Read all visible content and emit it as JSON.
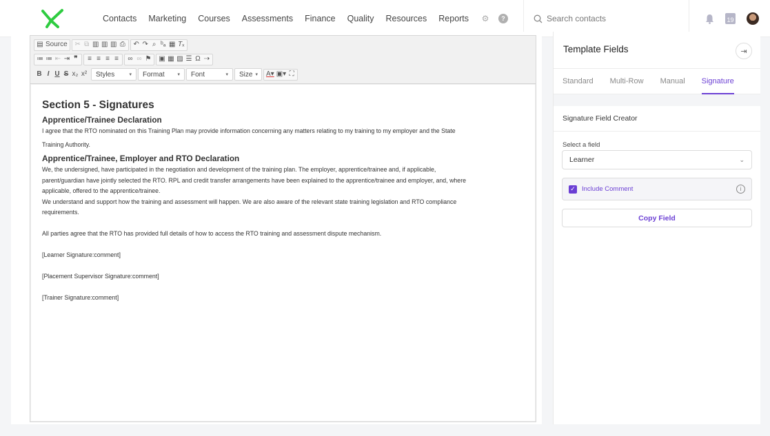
{
  "nav": {
    "items": [
      "Contacts",
      "Marketing",
      "Courses",
      "Assessments",
      "Finance",
      "Quality",
      "Resources",
      "Reports"
    ],
    "settings_icon": "gear-icon",
    "help_icon": "help-icon"
  },
  "search": {
    "placeholder": "Search contacts"
  },
  "header_right": {
    "calendar_day": "19"
  },
  "toolbar": {
    "source_label": "Source",
    "styles_label": "Styles",
    "format_label": "Format",
    "font_label": "Font",
    "size_label": "Size"
  },
  "document": {
    "heading": "Section 5 - Signatures",
    "sub1": "Apprentice/Trainee Declaration",
    "p1": "I agree that the RTO nominated on this Training Plan may provide information concerning any matters relating to my training to my employer and the State",
    "p1b": "Training Authority.",
    "sub2": "Apprentice/Trainee, Employer and RTO Declaration",
    "p2a": "We, the undersigned, have participated in the negotiation and development of the training plan.  The employer, apprentice/trainee and, if applicable,",
    "p2b": "parent/guardian have jointly selected the RTO.  RPL and credit transfer arrangements have been explained to the apprentice/trainee and employer, and, where",
    "p2c": "applicable, offered to the apprentice/trainee.",
    "p3a": "We understand and support how the training and assessment will happen. We are also aware of the relevant state training legislation and RTO compliance",
    "p3b": "requirements.",
    "p4": "All parties agree that the RTO has provided full details of how to access the RTO training and assessment dispute mechanism.",
    "sig1": "[Learner Signature:comment]",
    "sig2": "[Placement Supervisor Signature:comment]",
    "sig3": "[Trainer Signature:comment]"
  },
  "panel": {
    "title": "Template Fields",
    "tabs": [
      "Standard",
      "Multi-Row",
      "Manual",
      "Signature"
    ],
    "active_tab": "Signature",
    "card_title": "Signature Field Creator",
    "select_label": "Select a field",
    "select_value": "Learner",
    "checkbox_label": "Include Comment",
    "checkbox_checked": true,
    "copy_button": "Copy Field"
  },
  "colors": {
    "accent": "#6b3fd4",
    "logo": "#2ecc40"
  }
}
